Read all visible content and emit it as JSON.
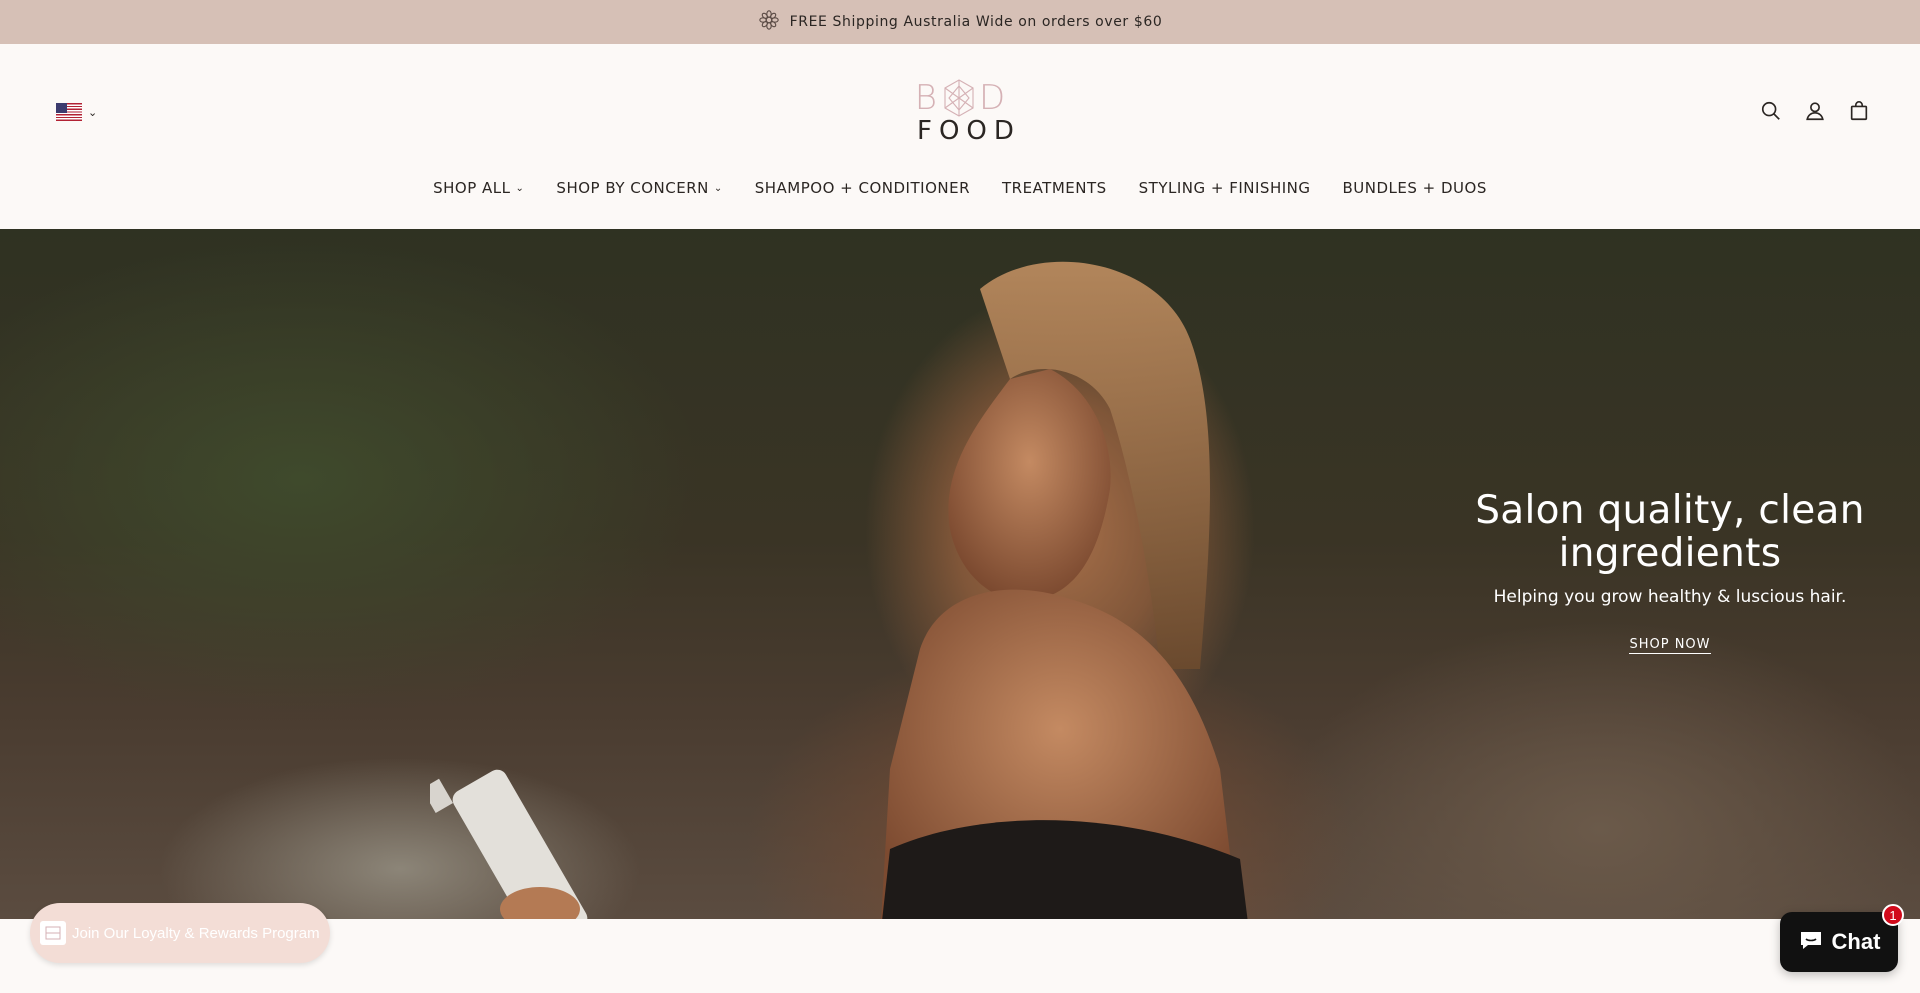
{
  "announcement": {
    "icon": "flower-icon",
    "text": "FREE Shipping Australia Wide on orders over $60"
  },
  "header": {
    "country_selector": {
      "flag": "us-flag-icon",
      "chevron": "⌄"
    },
    "logo": {
      "top": "B  D",
      "bottom": "FOOD"
    },
    "icons": [
      "search-icon",
      "account-icon",
      "bag-icon"
    ]
  },
  "nav": {
    "items": [
      {
        "label": "SHOP ALL",
        "dropdown": true
      },
      {
        "label": "SHOP BY CONCERN",
        "dropdown": true
      },
      {
        "label": "SHAMPOO + CONDITIONER",
        "dropdown": false
      },
      {
        "label": "TREATMENTS",
        "dropdown": false
      },
      {
        "label": "STYLING + FINISHING",
        "dropdown": false
      },
      {
        "label": "BUNDLES + DUOS",
        "dropdown": false
      }
    ]
  },
  "hero": {
    "title_line1": "Salon quality, clean",
    "title_line2": "ingredients",
    "subtitle": "Helping you grow healthy & luscious hair.",
    "cta": "SHOP NOW"
  },
  "loyalty": {
    "label": "Join Our Loyalty & Rewards Program"
  },
  "chat": {
    "label": "Chat",
    "badge": "1"
  },
  "colors": {
    "announcement_bg": "#d6c0b6",
    "page_bg": "#fcf9f7",
    "logo_accent": "#d5b1b5",
    "chat_bg": "#111111",
    "badge": "#d10a1b"
  }
}
